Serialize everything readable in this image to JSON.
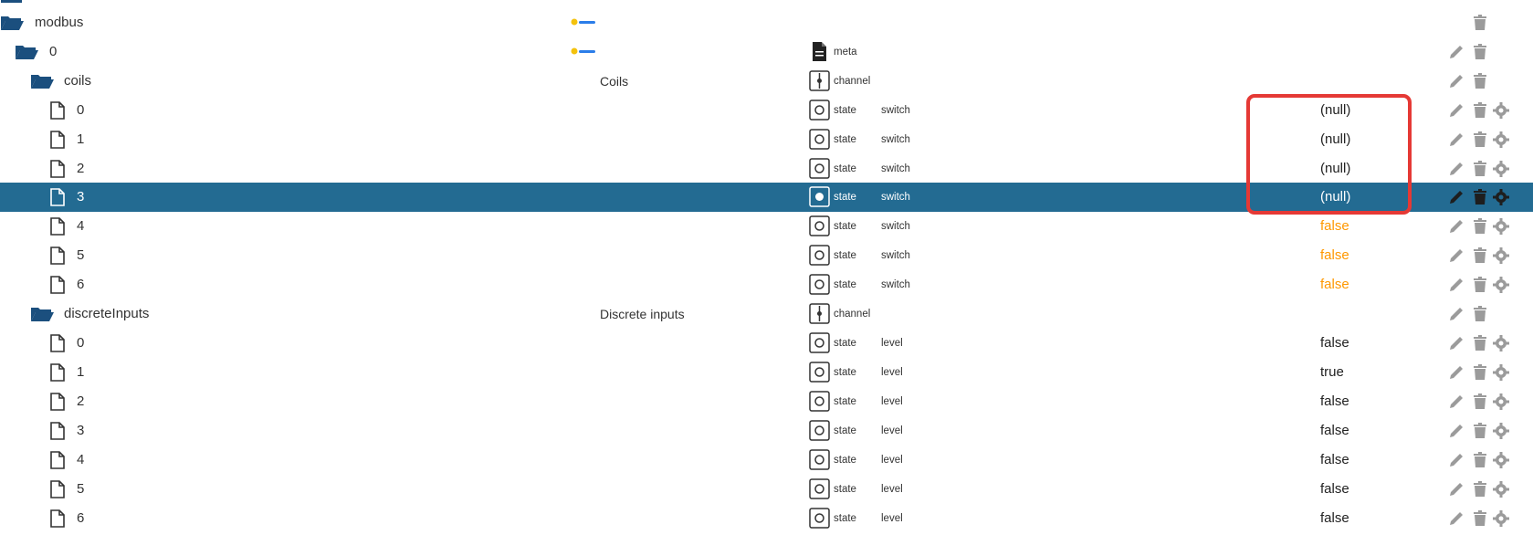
{
  "colors": {
    "selected_background": "#236b92",
    "folder_blue": "#1b4f7e",
    "icon_gray": "#9b9b9b",
    "highlight_red": "#e53935",
    "false_orange": "#ff9800"
  },
  "icons": {
    "folder": "folder-open-icon",
    "file": "file-icon",
    "meta": "meta-document-icon",
    "channel": "channel-icon",
    "state": "state-icon",
    "edit": "edit-icon",
    "delete": "delete-icon",
    "settings": "settings-gear-icon"
  },
  "tree": {
    "modbus": {
      "name": "modbus"
    },
    "instance": {
      "name": "0",
      "type": "meta"
    },
    "coils": {
      "name": "coils",
      "description": "Coils",
      "type": "channel",
      "items": [
        {
          "name": "0",
          "type": "state",
          "role": "switch",
          "value": "(null)"
        },
        {
          "name": "1",
          "type": "state",
          "role": "switch",
          "value": "(null)"
        },
        {
          "name": "2",
          "type": "state",
          "role": "switch",
          "value": "(null)"
        },
        {
          "name": "3",
          "type": "state",
          "role": "switch",
          "value": "(null)"
        },
        {
          "name": "4",
          "type": "state",
          "role": "switch",
          "value": "false"
        },
        {
          "name": "5",
          "type": "state",
          "role": "switch",
          "value": "false"
        },
        {
          "name": "6",
          "type": "state",
          "role": "switch",
          "value": "false"
        }
      ]
    },
    "discreteInputs": {
      "name": "discreteInputs",
      "description": "Discrete inputs",
      "type": "channel",
      "items": [
        {
          "name": "0",
          "type": "state",
          "role": "level",
          "value": "false"
        },
        {
          "name": "1",
          "type": "state",
          "role": "level",
          "value": "true"
        },
        {
          "name": "2",
          "type": "state",
          "role": "level",
          "value": "false"
        },
        {
          "name": "3",
          "type": "state",
          "role": "level",
          "value": "false"
        },
        {
          "name": "4",
          "type": "state",
          "role": "level",
          "value": "false"
        },
        {
          "name": "5",
          "type": "state",
          "role": "level",
          "value": "false"
        },
        {
          "name": "6",
          "type": "state",
          "role": "level",
          "value": "false"
        }
      ]
    }
  }
}
